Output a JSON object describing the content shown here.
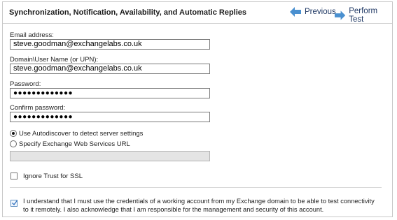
{
  "header": {
    "title": "Synchronization, Notification, Availability, and Automatic Replies",
    "previous_label": "Previous",
    "perform_label": "Perform Test",
    "arrow_color": "#4a90d0"
  },
  "form": {
    "email_label": "Email address:",
    "email_value": "steve.goodman@exchangelabs.co.uk",
    "username_label": "Domain\\User Name (or UPN):",
    "username_value": "steve.goodman@exchangelabs.co.uk",
    "password_label": "Password:",
    "password_value": "●●●●●●●●●●●●●",
    "confirm_label": "Confirm password:",
    "confirm_value": "●●●●●●●●●●●●●",
    "autodiscover_label": "Use Autodiscover to detect server settings",
    "autodiscover_selected": true,
    "ews_label": "Specify Exchange Web Services URL",
    "ews_selected": false,
    "ews_url_value": "",
    "ignore_ssl_label": "Ignore Trust for SSL",
    "ignore_ssl_checked": false,
    "acknowledge_text": "I understand that I must use the credentials of a working account from my Exchange domain to be able to test connectivity to it remotely. I also acknowledge that I am responsible for the management and security of this account.",
    "acknowledge_checked": true
  }
}
